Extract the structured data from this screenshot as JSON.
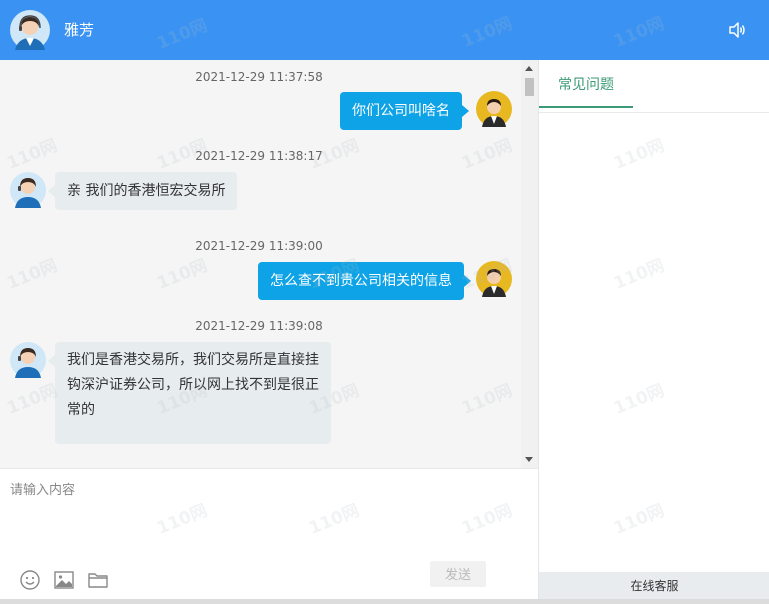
{
  "header": {
    "agent_name": "雅芳"
  },
  "messages": [
    {
      "timestamp": "2021-12-29 11:37:58",
      "side": "right",
      "text": "你们公司叫啥名"
    },
    {
      "timestamp": "2021-12-29 11:38:17",
      "side": "left",
      "text": "亲 我们的香港恒宏交易所"
    },
    {
      "timestamp": "2021-12-29 11:39:00",
      "side": "right",
      "text": "怎么查不到贵公司相关的信息"
    },
    {
      "timestamp": "2021-12-29 11:39:08",
      "side": "left",
      "text": "我们是香港交易所，我们交易所是直接挂钩深沪证券公司，所以网上找不到是很正常的"
    }
  ],
  "input": {
    "placeholder": "请输入内容",
    "value": "",
    "send_label": "发送"
  },
  "right_panel": {
    "tab_label": "常见问题",
    "footer_label": "在线客服"
  },
  "watermark": "110网",
  "colors": {
    "header_bg": "#3a93f2",
    "user_bubble": "#0ea3e6",
    "agent_bubble": "#e7ecee",
    "tab_active": "#3c9a76"
  }
}
